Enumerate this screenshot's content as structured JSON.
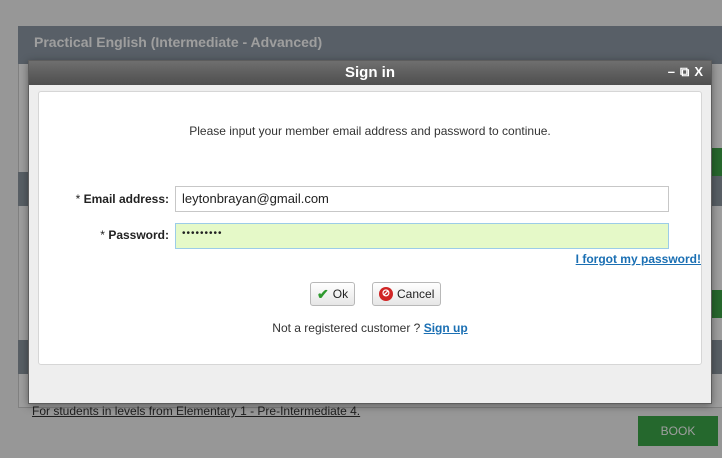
{
  "background": {
    "course_title": "Practical English (Intermediate - Advanced)",
    "footer_link": "For students in levels from Elementary 1 - Pre-Intermediate 4.",
    "book_label": "BOOK"
  },
  "dialog": {
    "title": "Sign in",
    "controls": {
      "minimize": "–",
      "restore": "⧉",
      "close": "X"
    },
    "intro": "Please input your member email address and password to continue.",
    "email_label": "Email address:",
    "email_value": "leytonbrayan@gmail.com",
    "password_label": "Password:",
    "password_value": "•••••••••",
    "required_marker": "*",
    "forgot_link": "I forgot my password!",
    "ok_label": "Ok",
    "cancel_label": "Cancel",
    "not_registered": "Not a registered customer ?",
    "signup_label": "Sign up"
  },
  "colors": {
    "accent_green": "#3da84a",
    "link_blue": "#1a6fb3",
    "active_input": "#e5f9c8"
  },
  "icons": [
    "checkmark-icon",
    "cancel-icon"
  ]
}
